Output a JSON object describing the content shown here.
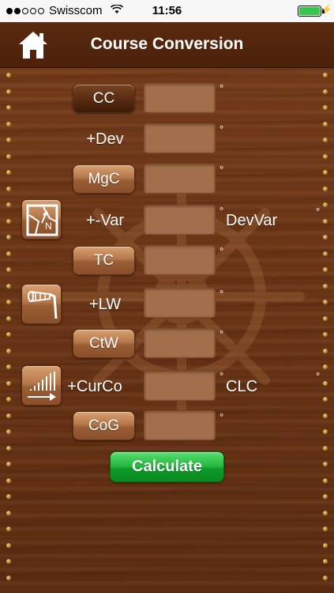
{
  "status_bar": {
    "carrier": "Swisscom",
    "time": "11:56",
    "signal_dots": 2,
    "battery_level": 1.0
  },
  "header": {
    "title": "Course Conversion",
    "home_icon": "home-icon"
  },
  "rows": [
    {
      "key": "cc",
      "label": "CC",
      "kind": "button",
      "selected": true,
      "value": "",
      "degree": "°"
    },
    {
      "key": "dev",
      "label": "+Dev",
      "kind": "label",
      "value": "",
      "degree": "°"
    },
    {
      "key": "mgc",
      "label": "MgC",
      "kind": "button",
      "value": "",
      "degree": "°"
    },
    {
      "key": "var",
      "label": "+-Var",
      "kind": "label",
      "value": "",
      "degree": "°",
      "side_label": "DevVar",
      "side_degree": "°"
    },
    {
      "key": "tc",
      "label": "TC",
      "kind": "button",
      "value": "",
      "degree": "°"
    },
    {
      "key": "lw",
      "label": "+LW",
      "kind": "label",
      "value": "",
      "degree": "°"
    },
    {
      "key": "ctw",
      "label": "CtW",
      "kind": "button",
      "value": "",
      "degree": "°"
    },
    {
      "key": "curco",
      "label": "+CurCo",
      "kind": "label",
      "value": "",
      "degree": "°",
      "side_label": "CLC",
      "side_degree": "°"
    },
    {
      "key": "cog",
      "label": "CoG",
      "kind": "button",
      "value": "",
      "degree": "°"
    }
  ],
  "icons": {
    "variation": "map-icon",
    "leeway": "windsock-icon",
    "current": "current-arrow-icon"
  },
  "calculate_label": "Calculate",
  "colors": {
    "wood": "#6e3717",
    "button_wood": "#b4764a",
    "field": "#a36e4b",
    "calculate": "#21b43b"
  }
}
